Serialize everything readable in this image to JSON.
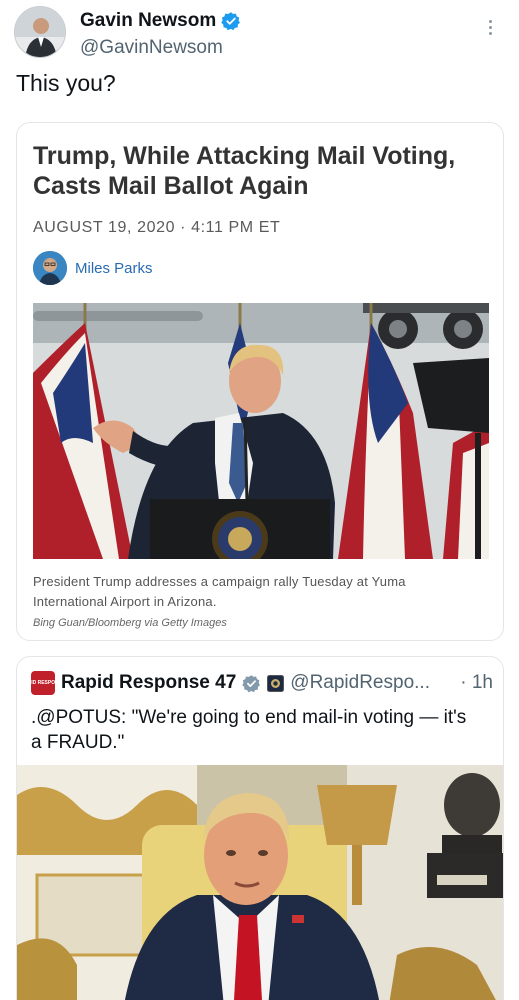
{
  "tweet": {
    "author_name": "Gavin Newsom",
    "author_handle": "@GavinNewsom",
    "text": "This you?",
    "icons": {
      "verified": "verified-badge-icon",
      "more": "more-options-icon"
    },
    "verified_color": "#1d9bf0"
  },
  "article": {
    "title": "Trump, While Attacking Mail Voting, Casts Mail Ballot Again",
    "date": "AUGUST 19, 2020 · 4:11 PM ET",
    "author": "Miles Parks",
    "caption": "President Trump addresses a campaign rally Tuesday at Yuma International Airport in Arizona.",
    "credit": "Bing Guan/Bloomberg via Getty Images",
    "author_link_color": "#2a6cb3"
  },
  "quoted_tweet": {
    "author_name": "Rapid Response 47",
    "author_handle": "@RapidRespo...",
    "time": "· 1h",
    "text": ".@POTUS: \"We're going to end mail-in voting — it's a FRAUD.\"",
    "logo_text": "RAPID RESPONSE",
    "icons": {
      "verified": "gray-verified-badge-icon",
      "affiliate": "affiliate-seal-icon"
    },
    "badge_color": "#829aab"
  }
}
